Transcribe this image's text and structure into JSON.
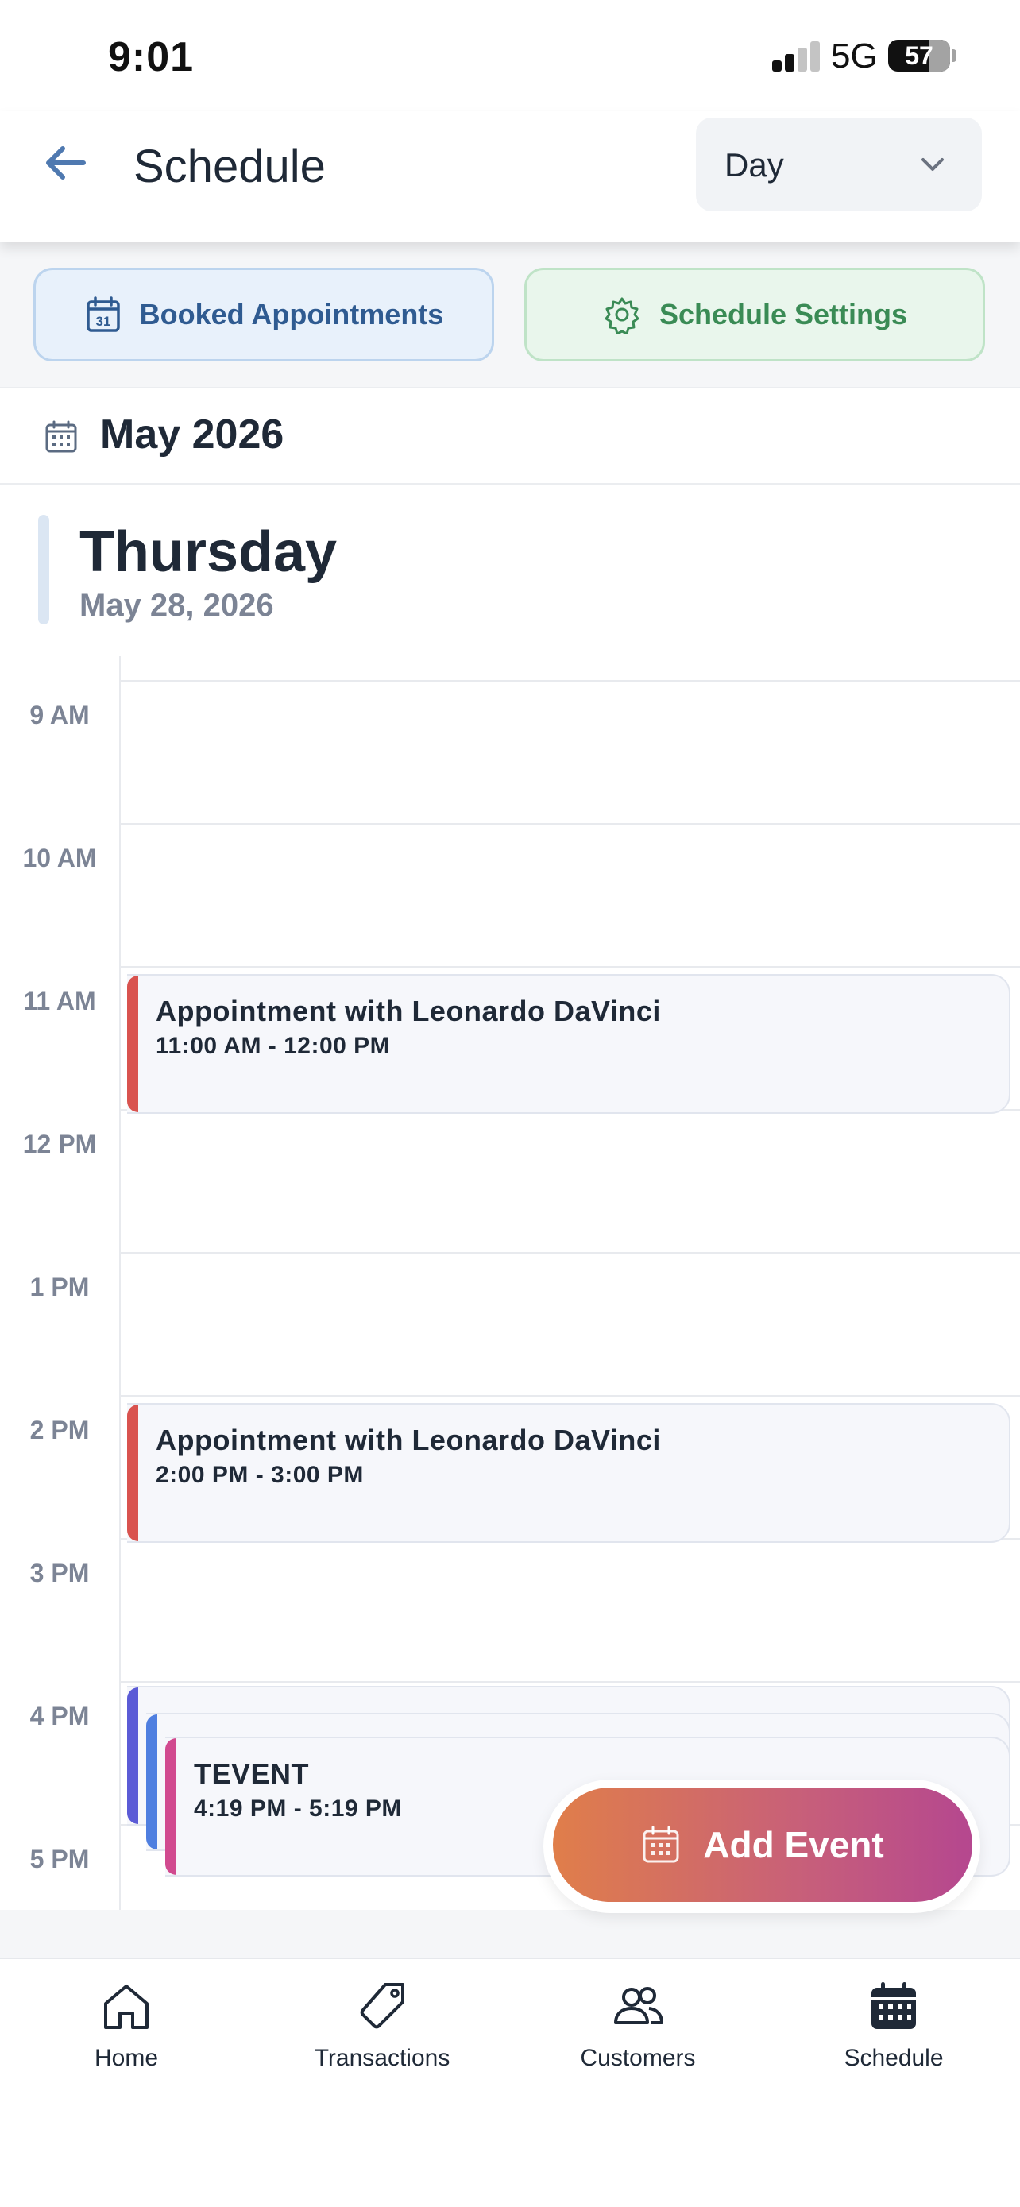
{
  "status_bar": {
    "time": "9:01",
    "network": "5G",
    "battery": "57"
  },
  "header": {
    "title": "Schedule",
    "view_mode": "Day"
  },
  "actions": {
    "booked_label": "Booked Appointments",
    "settings_label": "Schedule Settings"
  },
  "month": {
    "label": "May 2026"
  },
  "day": {
    "weekday": "Thursday",
    "date": "May 28, 2026"
  },
  "hours": [
    "9 AM",
    "10 AM",
    "11 AM",
    "12 PM",
    "1 PM",
    "2 PM",
    "3 PM",
    "4 PM",
    "5 PM"
  ],
  "events": [
    {
      "title": "Appointment with Leonardo DaVinci",
      "time": "11:00 AM - 12:00 PM",
      "color": "#d9534f"
    },
    {
      "title": "Appointment with Leonardo DaVinci",
      "time": "2:00 PM - 3:00 PM",
      "color": "#d9534f"
    },
    {
      "title": "",
      "time": "",
      "color": "#5b5bd6"
    },
    {
      "title": "",
      "time": "",
      "color": "#4f7fe0"
    },
    {
      "title": "TEVENT",
      "time": "4:19 PM - 5:19 PM",
      "color": "#d14a8f"
    }
  ],
  "fab": {
    "label": "Add Event"
  },
  "tabs": [
    {
      "label": "Home",
      "icon": "home-icon"
    },
    {
      "label": "Transactions",
      "icon": "tag-icon"
    },
    {
      "label": "Customers",
      "icon": "users-icon"
    },
    {
      "label": "Schedule",
      "icon": "calendar-icon"
    }
  ],
  "colors": {
    "booked_text": "#2f5b91",
    "settings_text": "#3a8b55",
    "fab_start": "#e07e4a",
    "fab_end": "#b5478f"
  }
}
